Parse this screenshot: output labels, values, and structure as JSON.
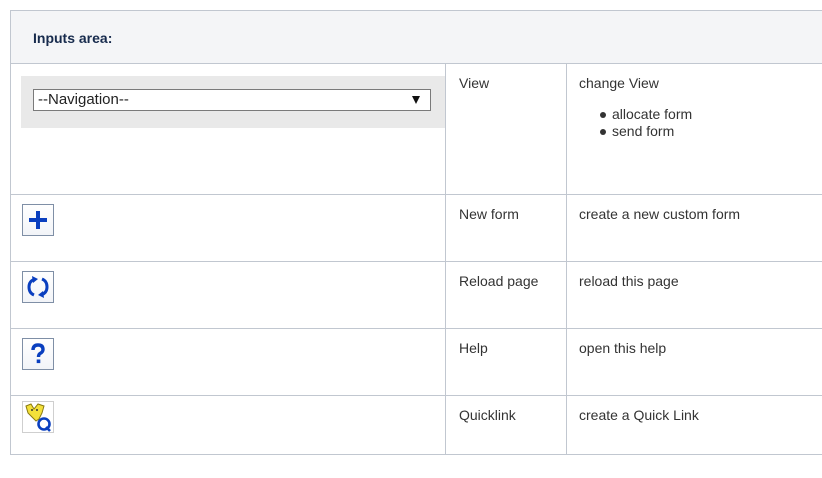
{
  "table": {
    "header": "Inputs area:",
    "navigation": {
      "select_value": "--Navigation--",
      "name": "View",
      "description": "change View",
      "options": [
        "allocate form",
        "send form"
      ]
    },
    "rows": [
      {
        "icon": "plus-icon",
        "name": "New form",
        "description": "create a new custom form"
      },
      {
        "icon": "reload-icon",
        "name": "Reload page",
        "description": "reload this page"
      },
      {
        "icon": "help-icon",
        "name": "Help",
        "description": "open this help"
      },
      {
        "icon": "quicklink-icon",
        "name": "Quicklink",
        "description": "create a Quick Link"
      }
    ]
  },
  "colors": {
    "icon_blue": "#0a3fbf",
    "border": "#c1c7d0",
    "header_bg": "#f4f5f7",
    "quicklink_yellow": "#f3e03a"
  }
}
